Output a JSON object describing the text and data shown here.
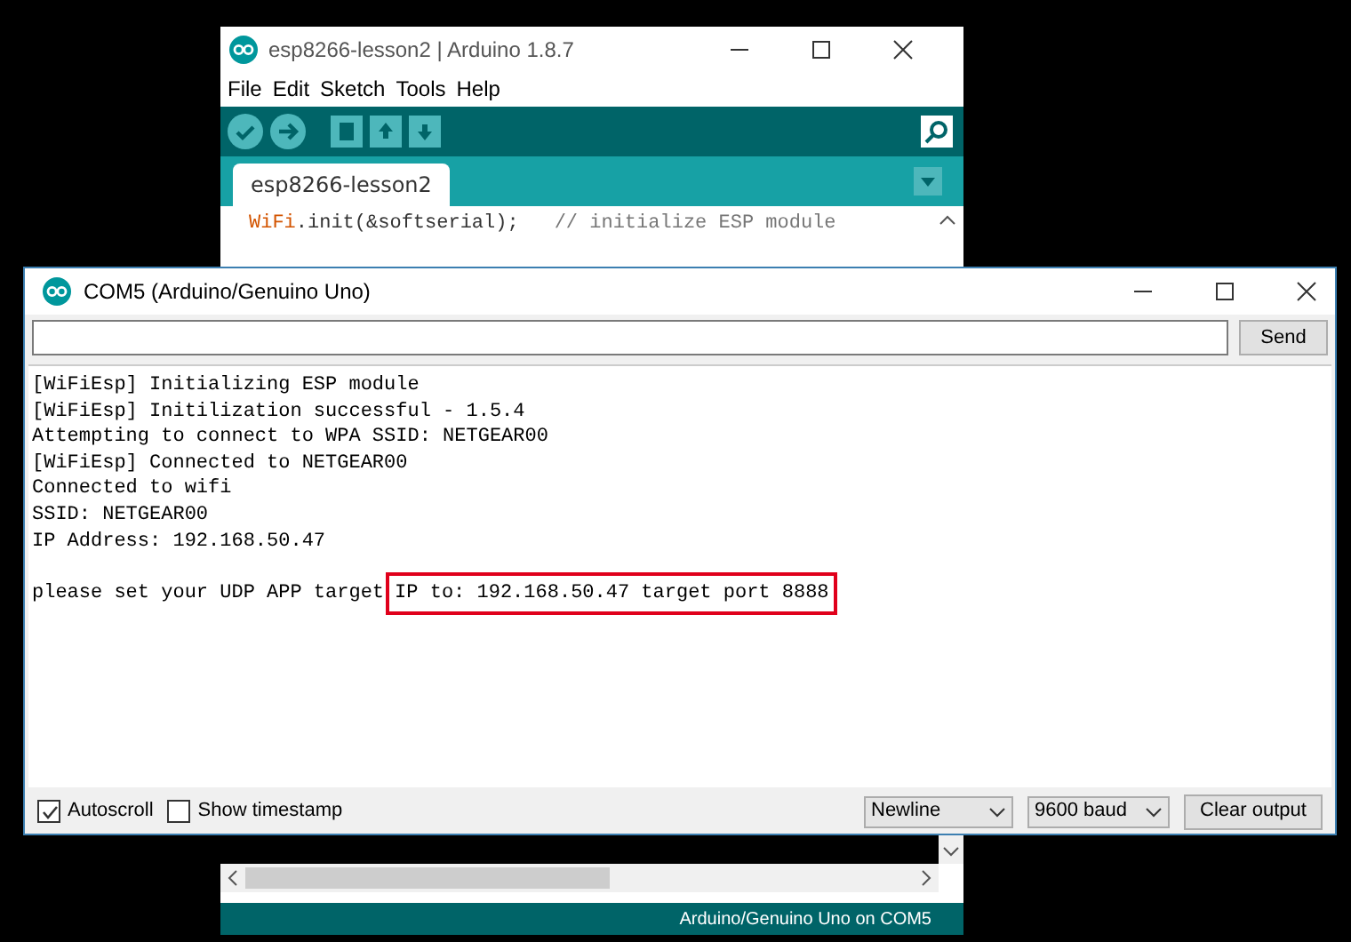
{
  "ide_window": {
    "title": "esp8266-lesson2 | Arduino 1.8.7",
    "menu": [
      "File",
      "Edit",
      "Sketch",
      "Tools",
      "Help"
    ],
    "tab": {
      "label": "esp8266-lesson2",
      "selected": true
    },
    "code_line": {
      "keyword": "WiFi",
      "rest": ".init(&softserial);",
      "comment": "// initialize ESP module"
    },
    "status_bar": "Arduino/Genuino Uno on COM5"
  },
  "serial_monitor": {
    "title": "COM5 (Arduino/Genuino Uno)",
    "send_button": "Send",
    "output": [
      [
        {
          "text": "[WiFiEsp] Initializing ESP module",
          "boxed": false
        }
      ],
      [
        {
          "text": "[WiFiEsp] Initilization successful - 1.5.4",
          "boxed": false
        }
      ],
      [
        {
          "text": "Attempting to connect to WPA SSID: NETGEAR00",
          "boxed": false
        }
      ],
      [
        {
          "text": "[WiFiEsp] Connected to NETGEAR00",
          "boxed": false
        }
      ],
      [
        {
          "text": "Connected to wifi",
          "boxed": false
        }
      ],
      [
        {
          "text": "SSID: NETGEAR00",
          "boxed": false
        }
      ],
      [
        {
          "text": "IP Address: 192.168.50.47",
          "boxed": false
        }
      ],
      [
        {
          "text": "please set your UDP APP target",
          "boxed": false,
          "gap_before": true
        },
        {
          "text": "IP to: 192.168.50.47 target port 8888",
          "boxed": true
        }
      ]
    ],
    "autoscroll": {
      "label": "Autoscroll",
      "checked": true
    },
    "timestamp": {
      "label": "Show timestamp",
      "checked": false
    },
    "line_ending": "Newline",
    "baud": "9600 baud",
    "clear_button": "Clear output"
  }
}
